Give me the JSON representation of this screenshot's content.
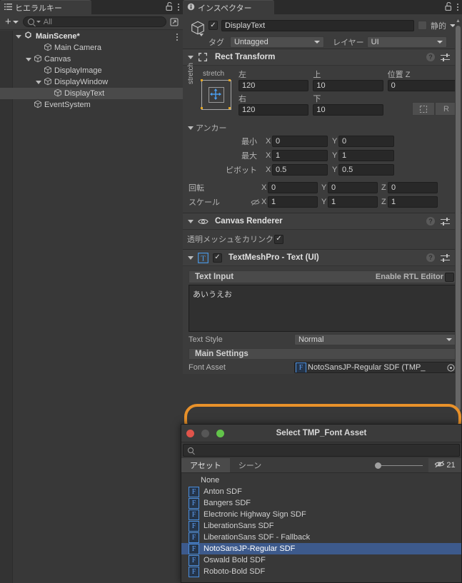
{
  "hierarchy": {
    "tab_label": "ヒエラルキー",
    "tab_icon": "hierarchy-icon",
    "lock_icon": "lock-open-icon",
    "menu_icon": "kebab-menu-icon",
    "add_label": "+",
    "search_placeholder": "All",
    "search_value": "",
    "items": [
      {
        "label": "MainScene*",
        "depth": 0,
        "icon": "unity-scene-icon",
        "foldout": "open",
        "selected": false
      },
      {
        "label": "Main Camera",
        "depth": 2,
        "icon": "gameobject-cube-icon",
        "foldout": "none",
        "selected": false
      },
      {
        "label": "Canvas",
        "depth": 1,
        "icon": "gameobject-cube-icon",
        "foldout": "open",
        "selected": false
      },
      {
        "label": "DisplayImage",
        "depth": 2,
        "icon": "gameobject-cube-icon",
        "foldout": "none",
        "selected": false
      },
      {
        "label": "DisplayWindow",
        "depth": 2,
        "icon": "gameobject-cube-icon",
        "foldout": "open",
        "selected": false
      },
      {
        "label": "DisplayText",
        "depth": 3,
        "icon": "gameobject-cube-icon",
        "foldout": "none",
        "selected": true
      },
      {
        "label": "EventSystem",
        "depth": 1,
        "icon": "gameobject-cube-icon",
        "foldout": "none",
        "selected": false
      }
    ]
  },
  "inspector": {
    "tab_label": "インスペクター",
    "tab_icon": "info-icon",
    "lock_icon": "lock-open-icon",
    "menu_icon": "kebab-menu-icon",
    "object": {
      "enabled": true,
      "name": "DisplayText",
      "static_label": "静的",
      "static_checked": false,
      "tag_label": "タグ",
      "tag_value": "Untagged",
      "layer_label": "レイヤー",
      "layer_value": "UI"
    },
    "rect_transform": {
      "title": "Rect Transform",
      "anchor_preset_top": "stretch",
      "anchor_preset_left": "stretch",
      "left_label": "左",
      "left_value": "120",
      "top_label": "上",
      "top_value": "10",
      "posz_label": "位置 Z",
      "posz_value": "0",
      "right_label": "右",
      "right_value": "120",
      "bottom_label": "下",
      "bottom_value": "10",
      "blueprint_button": "blueprint-mode-icon",
      "raw_button": "R",
      "anchors_label": "アンカー",
      "min_label": "最小",
      "min_x": "0",
      "min_y": "0",
      "max_label": "最大",
      "max_x": "1",
      "max_y": "1",
      "pivot_label": "ピボット",
      "pivot_x": "0.5",
      "pivot_y": "0.5",
      "rotation_label": "回転",
      "rot_x": "0",
      "rot_y": "0",
      "rot_z": "0",
      "scale_label": "スケール",
      "scale_x": "1",
      "scale_y": "1",
      "scale_z": "1",
      "axis_x": "X",
      "axis_y": "Y",
      "axis_z": "Z"
    },
    "canvas_renderer": {
      "title": "Canvas Renderer",
      "cull_label": "透明メッシュをカリンク",
      "cull_checked": true
    },
    "tmp": {
      "title": "TextMeshPro - Text (UI)",
      "enabled": true,
      "icon": "tmp-text-icon",
      "text_input_label": "Text Input",
      "rtl_label": "Enable RTL Editor",
      "rtl_checked": false,
      "text_value": "あいうえお",
      "text_style_label": "Text Style",
      "text_style_value": "Normal",
      "main_settings_label": "Main Settings",
      "font_asset_label": "Font Asset",
      "font_asset_value": "NotoSansJP-Regular SDF (TMP_",
      "font_asset_icon": "font-asset-F-icon",
      "object_picker_icon": "object-picker-icon"
    }
  },
  "modal": {
    "title": "Select TMP_Font Asset",
    "close_button": "close-traffic-light",
    "minimize_button": "minimize-traffic-light",
    "zoom_button": "zoom-traffic-light",
    "search_value": "",
    "search_icon": "search-icon",
    "tabs": [
      {
        "label": "アセット",
        "active": true
      },
      {
        "label": "シーン",
        "active": false
      }
    ],
    "preview_size_slider": 0,
    "visibility_icon": "eye-off-icon",
    "visibility_count": "21",
    "items": [
      {
        "label": "None",
        "icon": "none",
        "selected": false
      },
      {
        "label": "Anton SDF",
        "icon": "font-asset-F-icon",
        "selected": false
      },
      {
        "label": "Bangers SDF",
        "icon": "font-asset-F-icon",
        "selected": false
      },
      {
        "label": "Electronic Highway Sign SDF",
        "icon": "font-asset-F-icon",
        "selected": false
      },
      {
        "label": "LiberationSans SDF",
        "icon": "font-asset-F-icon",
        "selected": false
      },
      {
        "label": "LiberationSans SDF - Fallback",
        "icon": "font-asset-F-icon",
        "selected": false
      },
      {
        "label": "NotoSansJP-Regular SDF",
        "icon": "font-asset-F-icon",
        "selected": true
      },
      {
        "label": "Oswald Bold SDF",
        "icon": "font-asset-F-icon",
        "selected": false
      },
      {
        "label": "Roboto-Bold SDF",
        "icon": "font-asset-F-icon",
        "selected": false
      }
    ]
  },
  "annotation": {
    "highlight_shape": "orange-ellipse",
    "highlight_color": "#e8912a",
    "highlight_target": "font-asset-row"
  },
  "colors": {
    "window_bg": "#383838",
    "panel_bg": "#3c3c3c",
    "tab_bg": "#2b2b2b",
    "field_bg": "#282828",
    "selection_blue": "#3d5a8c",
    "hierarchy_selection": "#4a4a4a",
    "accent_orange": "#e8912a",
    "icon_blue": "#5b9bf0"
  }
}
